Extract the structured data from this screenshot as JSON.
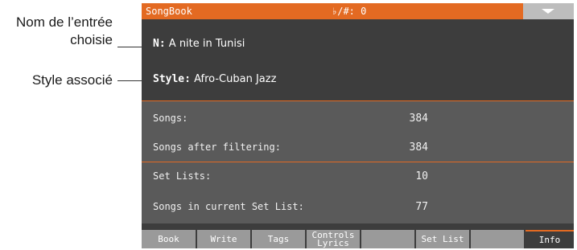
{
  "annotations": {
    "entry_name": "Nom de l’entrée choisie",
    "associated_style": "Style associé"
  },
  "titlebar": {
    "app_title": "SongBook",
    "key_signature": "♭/#: 0",
    "menu_icon": "triangle-down-icon"
  },
  "entry": {
    "name_label": "N:",
    "name_value": "A nite in Tunisi",
    "style_label": "Style:",
    "style_value": "Afro-Cuban Jazz"
  },
  "info": {
    "songs_label": "Songs:",
    "songs_value": "384",
    "filtered_label": "Songs after filtering:",
    "filtered_value": "384",
    "setlists_label": "Set Lists:",
    "setlists_value": "10",
    "current_setlist_label": "Songs in current Set List:",
    "current_setlist_value": "77"
  },
  "tabs": [
    {
      "label": "Book"
    },
    {
      "label": "Write"
    },
    {
      "label": "Tags"
    },
    {
      "label": "Controls Lyrics"
    },
    {
      "label": ""
    },
    {
      "label": "Set List"
    },
    {
      "label": ""
    },
    {
      "label": "Info"
    }
  ],
  "colors": {
    "accent": "#e36a22",
    "screen_bg": "#3d3d3d",
    "tab_bg": "#9a9a9a"
  }
}
